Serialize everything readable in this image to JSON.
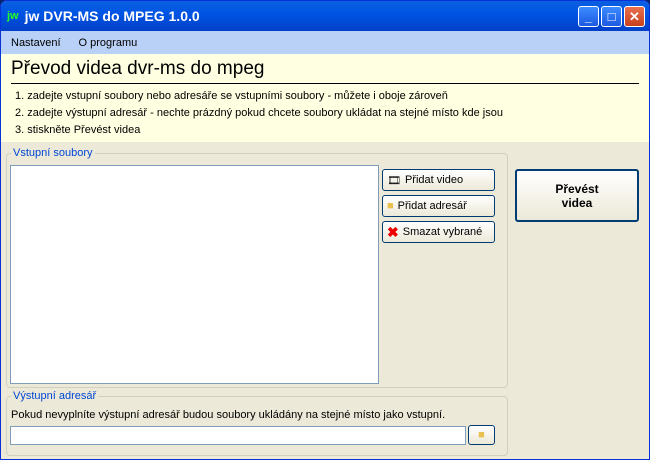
{
  "window": {
    "title": "jw DVR-MS do MPEG 1.0.0",
    "logo": "jw"
  },
  "menu": [
    "Nastavení",
    "O programu"
  ],
  "header": {
    "title": "Převod videa dvr-ms do mpeg",
    "steps": [
      "1. zadejte vstupní soubory nebo adresáře se vstupními soubory - můžete i oboje zároveň",
      "2. zadejte výstupní adresář - nechte prázdný pokud chcete soubory ukládat na stejné místo kde jsou",
      "3. stiskněte Převést videa"
    ]
  },
  "input_group": {
    "label": "Vstupní soubory",
    "add_video": "Přidat video",
    "add_folder": "Přidat adresář",
    "delete_selected": "Smazat vybrané"
  },
  "convert": {
    "line1": "Převést",
    "line2": "videa"
  },
  "output_group": {
    "label": "Výstupní adresář",
    "hint": "Pokud nevyplníte výstupní adresář budou soubory ukládány na stejné místo jako vstupní.",
    "value": ""
  }
}
